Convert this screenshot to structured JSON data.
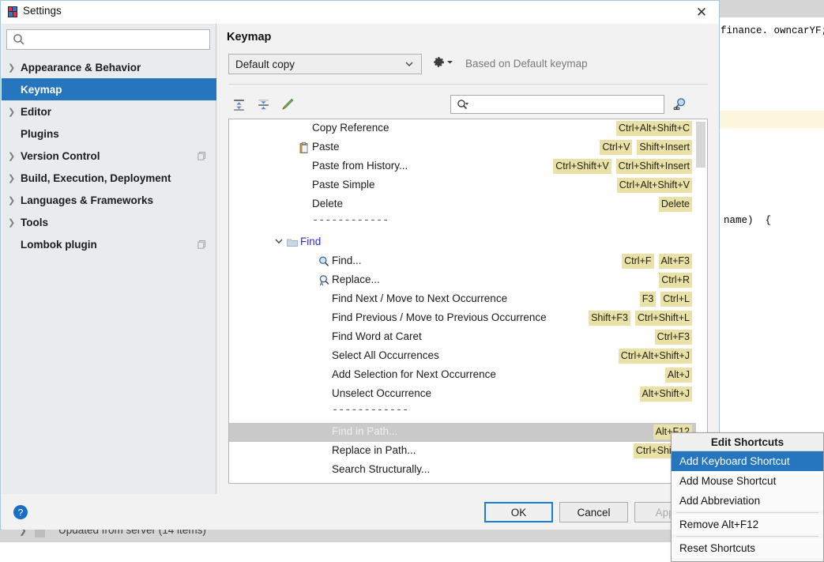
{
  "background": {
    "code_line_1": "finance. owncarYF;",
    "code_line_2": "g name)  {",
    "status_row": "Updated from server (14 items)"
  },
  "dialog": {
    "title": "Settings",
    "title_icon": "intellij-logo-icon",
    "close_label": "✕"
  },
  "sidebar": {
    "search_placeholder": "",
    "search_value": "",
    "items": [
      {
        "label": "Appearance & Behavior",
        "expandable": true,
        "selected": false,
        "badge": false
      },
      {
        "label": "Keymap",
        "expandable": false,
        "selected": true,
        "badge": false
      },
      {
        "label": "Editor",
        "expandable": true,
        "selected": false,
        "badge": false
      },
      {
        "label": "Plugins",
        "expandable": false,
        "selected": false,
        "badge": false
      },
      {
        "label": "Version Control",
        "expandable": true,
        "selected": false,
        "badge": true
      },
      {
        "label": "Build, Execution, Deployment",
        "expandable": true,
        "selected": false,
        "badge": false
      },
      {
        "label": "Languages & Frameworks",
        "expandable": true,
        "selected": false,
        "badge": false
      },
      {
        "label": "Tools",
        "expandable": true,
        "selected": false,
        "badge": false
      },
      {
        "label": "Lombok plugin",
        "expandable": false,
        "selected": false,
        "badge": true
      }
    ]
  },
  "panel": {
    "title": "Keymap",
    "keymap_selected": "Default copy",
    "based_on": "Based on Default keymap",
    "gear_icon": "gear-icon",
    "toolbar": {
      "expand_all_icon": "expand-all-icon",
      "collapse_all_icon": "collapse-all-icon",
      "edit_icon": "edit-pencil-icon",
      "filter_value": "",
      "filter_placeholder": "",
      "filter_icon": "search-icon",
      "find_shortcut_icon": "find-by-shortcut-icon"
    }
  },
  "tree": [
    {
      "indent": 105,
      "label": "Copy Reference",
      "type": "action",
      "icon": null,
      "shortcuts": [
        "Ctrl+Alt+Shift+C"
      ],
      "selected": false
    },
    {
      "indent": 105,
      "label": "Paste",
      "type": "action",
      "icon": "paste-icon",
      "shortcuts": [
        "Ctrl+V",
        "Shift+Insert"
      ],
      "selected": false
    },
    {
      "indent": 105,
      "label": "Paste from History...",
      "type": "action",
      "icon": null,
      "shortcuts": [
        "Ctrl+Shift+V",
        "Ctrl+Shift+Insert"
      ],
      "selected": false
    },
    {
      "indent": 105,
      "label": "Paste Simple",
      "type": "action",
      "icon": null,
      "shortcuts": [
        "Ctrl+Alt+Shift+V"
      ],
      "selected": false
    },
    {
      "indent": 105,
      "label": "Delete",
      "type": "action",
      "icon": null,
      "shortcuts": [
        "Delete"
      ],
      "selected": false
    },
    {
      "indent": 105,
      "label": "------------",
      "type": "separator",
      "icon": null,
      "shortcuts": [],
      "selected": false
    },
    {
      "indent": 90,
      "label": "Find",
      "type": "group",
      "icon": "folder-icon",
      "shortcuts": [],
      "selected": false,
      "expander": "⌄"
    },
    {
      "indent": 130,
      "label": "Find...",
      "type": "action",
      "icon": "find-icon",
      "shortcuts": [
        "Ctrl+F",
        "Alt+F3"
      ],
      "selected": false
    },
    {
      "indent": 130,
      "label": "Replace...",
      "type": "action",
      "icon": "replace-icon",
      "shortcuts": [
        "Ctrl+R"
      ],
      "selected": false
    },
    {
      "indent": 130,
      "label": "Find Next / Move to Next Occurrence",
      "type": "action",
      "icon": null,
      "shortcuts": [
        "F3",
        "Ctrl+L"
      ],
      "selected": false
    },
    {
      "indent": 130,
      "label": "Find Previous / Move to Previous Occurrence",
      "type": "action",
      "icon": null,
      "shortcuts": [
        "Shift+F3",
        "Ctrl+Shift+L"
      ],
      "selected": false
    },
    {
      "indent": 130,
      "label": "Find Word at Caret",
      "type": "action",
      "icon": null,
      "shortcuts": [
        "Ctrl+F3"
      ],
      "selected": false
    },
    {
      "indent": 130,
      "label": "Select All Occurrences",
      "type": "action",
      "icon": null,
      "shortcuts": [
        "Ctrl+Alt+Shift+J"
      ],
      "selected": false
    },
    {
      "indent": 130,
      "label": "Add Selection for Next Occurrence",
      "type": "action",
      "icon": null,
      "shortcuts": [
        "Alt+J"
      ],
      "selected": false
    },
    {
      "indent": 130,
      "label": "Unselect Occurrence",
      "type": "action",
      "icon": null,
      "shortcuts": [
        "Alt+Shift+J"
      ],
      "selected": false
    },
    {
      "indent": 130,
      "label": "------------",
      "type": "separator",
      "icon": null,
      "shortcuts": [],
      "selected": false
    },
    {
      "indent": 130,
      "label": "Find in Path...",
      "type": "action",
      "icon": null,
      "shortcuts": [
        "Alt+F12"
      ],
      "selected": true
    },
    {
      "indent": 130,
      "label": "Replace in Path...",
      "type": "action",
      "icon": null,
      "shortcuts": [
        "Ctrl+Shift+R"
      ],
      "selected": false
    },
    {
      "indent": 130,
      "label": "Search Structurally...",
      "type": "action",
      "icon": null,
      "shortcuts": [],
      "selected": false
    }
  ],
  "buttons": {
    "help_icon": "help-icon",
    "ok": "OK",
    "cancel": "Cancel",
    "apply": "Apply"
  },
  "context_menu": {
    "title": "Edit Shortcuts",
    "items": [
      {
        "label": "Add Keyboard Shortcut",
        "highlight": true,
        "divider_after": false
      },
      {
        "label": "Add Mouse Shortcut",
        "highlight": false,
        "divider_after": false
      },
      {
        "label": "Add Abbreviation",
        "highlight": false,
        "divider_after": true
      },
      {
        "label": "Remove Alt+F12",
        "highlight": false,
        "divider_after": true
      },
      {
        "label": "Reset Shortcuts",
        "highlight": false,
        "divider_after": false
      }
    ]
  },
  "colors": {
    "accent": "#2675bf",
    "shortcut_badge": "#e9e1a6",
    "sidebar_bg": "#e8ecef",
    "selected_row": "#c9c9c9"
  }
}
